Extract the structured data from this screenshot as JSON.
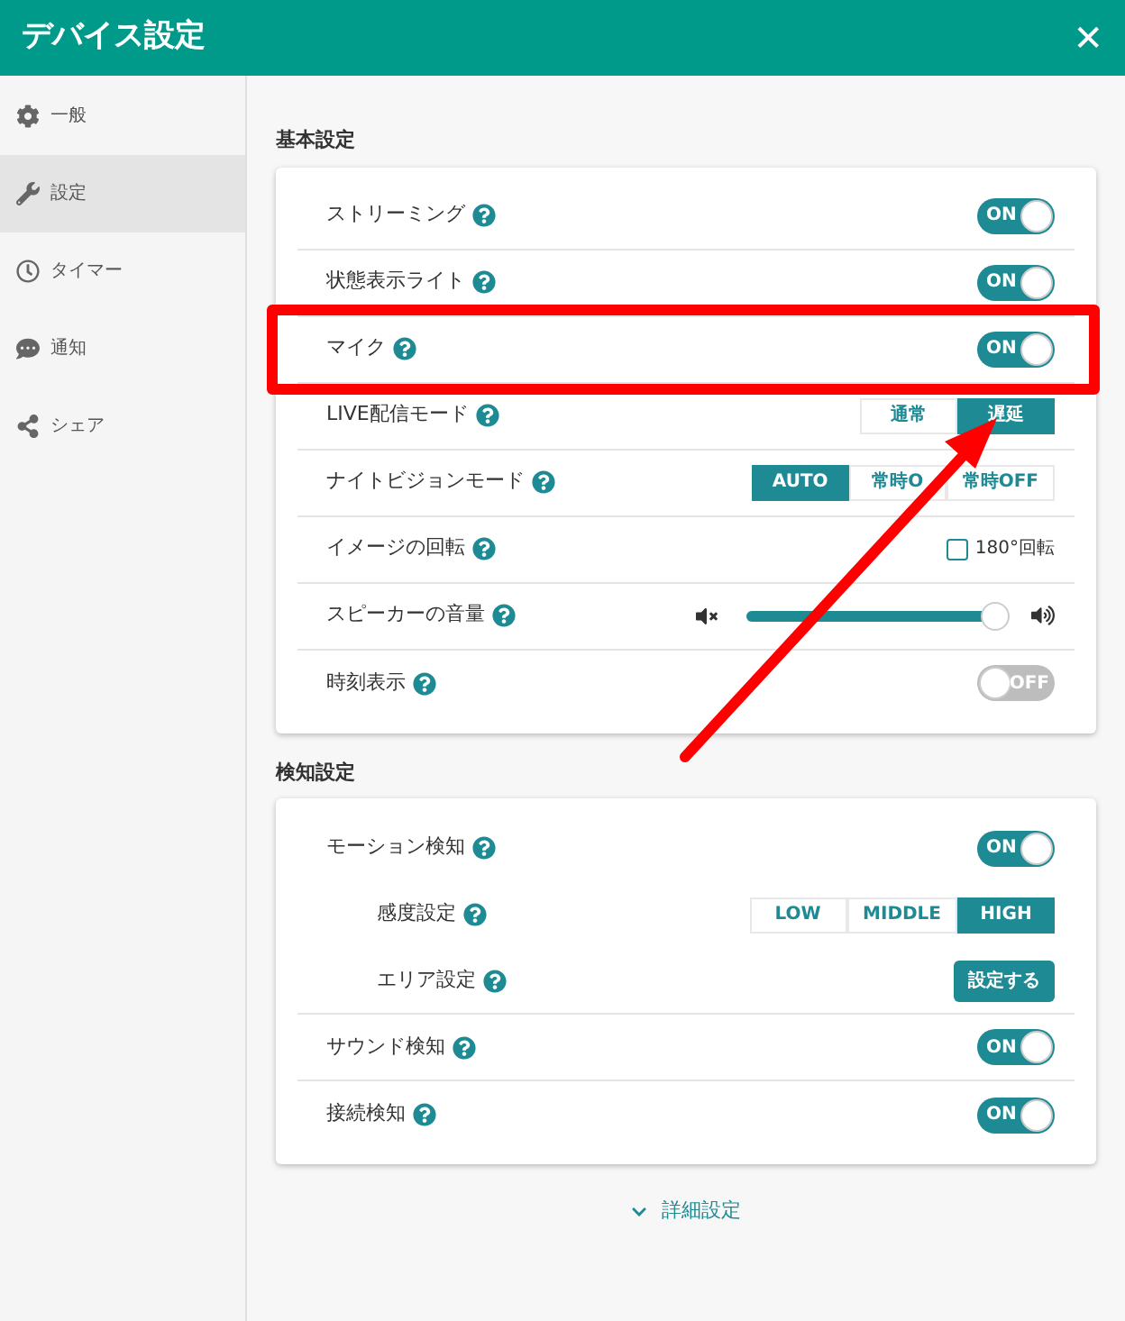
{
  "window": {
    "title": "デバイス設定",
    "close": "✕"
  },
  "sidebar": {
    "items": [
      {
        "label": "一般",
        "selected": false
      },
      {
        "label": "設定",
        "selected": true
      },
      {
        "label": "タイマー",
        "selected": false
      },
      {
        "label": "通知",
        "selected": false
      },
      {
        "label": "シェア",
        "selected": false
      }
    ]
  },
  "sections": [
    {
      "title": "基本設定",
      "rows": [
        {
          "kind": "toggle",
          "label": "ストリーミング",
          "on": true,
          "text": "ON"
        },
        {
          "kind": "toggle",
          "label": "状態表示ライト",
          "on": true,
          "text": "ON"
        },
        {
          "kind": "toggle",
          "label": "マイク",
          "on": true,
          "text": "ON",
          "highlighted": true
        },
        {
          "kind": "segmented",
          "label": "LIVE配信モード",
          "options": [
            {
              "label": "通常",
              "selected": false
            },
            {
              "label": "遅延",
              "selected": true
            }
          ]
        },
        {
          "kind": "segmented",
          "label": "ナイトビジョンモード",
          "options": [
            {
              "label": "AUTO",
              "selected": true
            },
            {
              "label": "常時O",
              "selected": false
            },
            {
              "label": "常時OFF",
              "selected": false
            }
          ]
        },
        {
          "kind": "checkbox",
          "label": "イメージの回転",
          "checked": false,
          "text": "180°回転"
        },
        {
          "kind": "slider",
          "label": "スピーカーの音量",
          "level": 0.97
        },
        {
          "kind": "toggle",
          "label": "時刻表示",
          "on": false,
          "text": "OFF"
        }
      ]
    },
    {
      "title": "検知設定",
      "rows": [
        {
          "kind": "toggle",
          "label": "モーション検知",
          "on": true,
          "text": "ON",
          "children": [
            {
              "kind": "segmented",
              "label": "感度設定",
              "options": [
                {
                  "label": "LOW",
                  "selected": false
                },
                {
                  "label": "MIDDLE",
                  "selected": false
                },
                {
                  "label": "HIGH",
                  "selected": true
                }
              ]
            },
            {
              "kind": "button",
              "label": "エリア設定",
              "text": "設定する"
            }
          ]
        },
        {
          "kind": "toggle",
          "label": "サウンド検知",
          "on": true,
          "text": "ON"
        },
        {
          "kind": "toggle",
          "label": "接続検知",
          "on": true,
          "text": "ON"
        }
      ]
    }
  ],
  "advanced_link": "詳細設定"
}
